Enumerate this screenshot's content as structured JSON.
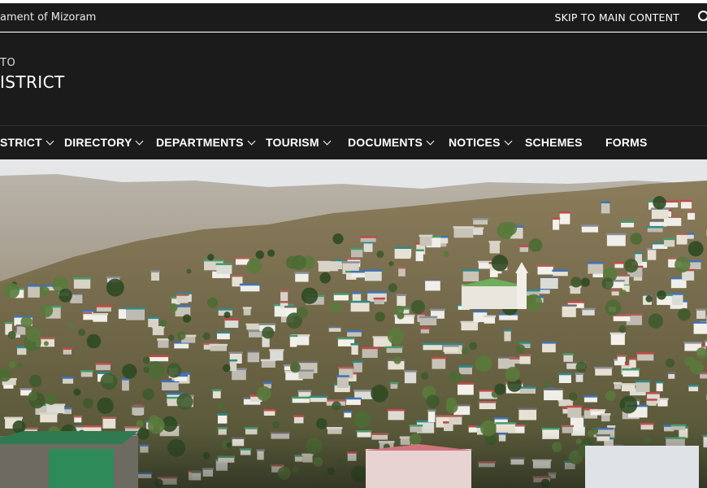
{
  "topbar": {
    "government_text": "ament of Mizoram",
    "skip_link": "SKIP TO MAIN CONTENT"
  },
  "site": {
    "subtitle": "TO",
    "title": "ISTRICT"
  },
  "nav": {
    "items": [
      {
        "label": "STRICT",
        "has_dropdown": true
      },
      {
        "label": "DIRECTORY",
        "has_dropdown": true
      },
      {
        "label": "DEPARTMENTS",
        "has_dropdown": true
      },
      {
        "label": "TOURISM",
        "has_dropdown": true
      },
      {
        "label": "DOCUMENTS",
        "has_dropdown": true
      },
      {
        "label": "NOTICES",
        "has_dropdown": true
      },
      {
        "label": "SCHEMES",
        "has_dropdown": false
      },
      {
        "label": "FORMS",
        "has_dropdown": false
      }
    ]
  },
  "colors": {
    "header_bg": "#1b1b1b",
    "text": "#ffffff"
  },
  "icons": {
    "search": "search-icon",
    "dropdown": "chevron-down-icon"
  }
}
